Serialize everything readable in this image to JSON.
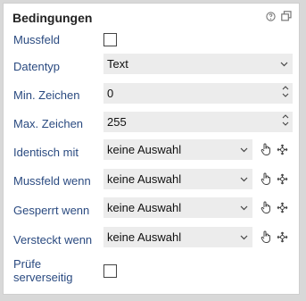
{
  "panel": {
    "title": "Bedingungen",
    "help_icon": "help-circle-icon",
    "window_icon": "copy-window-icon"
  },
  "fields": {
    "mussfeld": {
      "label": "Mussfeld",
      "checked": false
    },
    "datentyp": {
      "label": "Datentyp",
      "value": "Text"
    },
    "min_zeichen": {
      "label": "Min. Zeichen",
      "value": "0"
    },
    "max_zeichen": {
      "label": "Max. Zeichen",
      "value": "255"
    },
    "identisch_mit": {
      "label": "Identisch mit",
      "value": "keine Auswahl"
    },
    "mussfeld_wenn": {
      "label": "Mussfeld wenn",
      "value": "keine Auswahl"
    },
    "gesperrt_wenn": {
      "label": "Gesperrt wenn",
      "value": "keine Auswahl"
    },
    "versteckt_wenn": {
      "label": "Versteckt wenn",
      "value": "keine Auswahl"
    },
    "pruefe_serverseitig": {
      "label_line1": "Prüfe",
      "label_line2": "serverseitig",
      "checked": false
    }
  },
  "icons": {
    "pick": "hand-pointer-icon",
    "move": "move-crosshair-icon"
  }
}
